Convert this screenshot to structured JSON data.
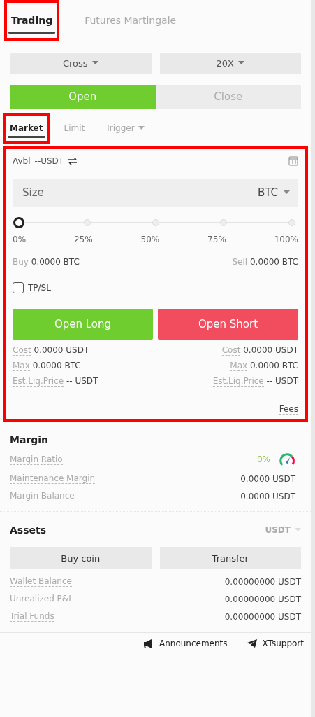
{
  "top_tabs": [
    {
      "label": "Trading",
      "selected": true,
      "highlighted": true
    },
    {
      "label": "Futures Martingale",
      "selected": false,
      "highlighted": false
    }
  ],
  "selectors": [
    {
      "label": "Cross"
    },
    {
      "label": "20X"
    }
  ],
  "side_toggle": [
    {
      "label": "Open",
      "selected": true
    },
    {
      "label": "Close",
      "selected": false
    }
  ],
  "order_tabs": [
    {
      "label": "Market",
      "selected": true,
      "highlighted": true,
      "dropdown": false
    },
    {
      "label": "Limit",
      "selected": false,
      "highlighted": false,
      "dropdown": false
    },
    {
      "label": "Trigger",
      "selected": false,
      "highlighted": false,
      "dropdown": true
    }
  ],
  "order_form": {
    "highlighted": true,
    "available": {
      "label": "Avbl",
      "value": "--USDT"
    },
    "size_field": {
      "placeholder": "Size",
      "unit": "BTC"
    },
    "slider": {
      "level": 0,
      "ticks": [
        "0%",
        "25%",
        "50%",
        "75%",
        "100%"
      ]
    },
    "buy": {
      "label": "Buy",
      "value": "0.0000 BTC"
    },
    "sell": {
      "label": "Sell",
      "value": "0.0000 BTC"
    },
    "tpsl": {
      "label": "TP/SL",
      "checked": false
    },
    "buttons": [
      {
        "label": "Open Long",
        "kind": "long"
      },
      {
        "label": "Open Short",
        "kind": "short"
      }
    ],
    "stats": [
      {
        "left": {
          "label": "Cost",
          "value": "0.0000 USDT"
        },
        "right": {
          "label": "Cost",
          "value": "0.0000 USDT"
        }
      },
      {
        "left": {
          "label": "Max",
          "value": "0.0000 BTC"
        },
        "right": {
          "label": "Max",
          "value": "0.0000 BTC"
        }
      },
      {
        "left": {
          "label": "Est.Liq.Price",
          "value": "-- USDT"
        },
        "right": {
          "label": "Est.Liq.Price",
          "value": "-- USDT"
        }
      }
    ],
    "fees": "Fees"
  },
  "margin": {
    "title": "Margin",
    "rows": [
      {
        "label": "Margin Ratio",
        "value": "0%",
        "kind": "ratio"
      },
      {
        "label": "Maintenance Margin",
        "value": "0.0000 USDT",
        "kind": "plain"
      },
      {
        "label": "Margin Balance",
        "value": "0.0000 USDT",
        "kind": "plain"
      }
    ]
  },
  "assets": {
    "title": "Assets",
    "currency": "USDT",
    "buttons": [
      "Buy coin",
      "Transfer"
    ],
    "rows": [
      {
        "label": "Wallet Balance",
        "value": "0.00000000 USDT"
      },
      {
        "label": "Unrealized P&L",
        "value": "0.00000000 USDT"
      },
      {
        "label": "Trial Funds",
        "value": "0.00000000 USDT"
      }
    ]
  },
  "footer": [
    {
      "label": "Announcements",
      "kind": "megaphone"
    },
    {
      "label": "XTsupport",
      "kind": "telegram"
    }
  ]
}
